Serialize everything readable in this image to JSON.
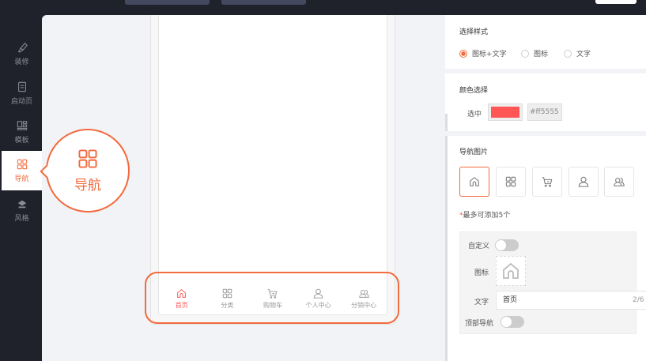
{
  "sidebar": {
    "items": [
      {
        "label": "装修",
        "icon": "brush-icon"
      },
      {
        "label": "启动页",
        "icon": "document-icon"
      },
      {
        "label": "模板",
        "icon": "template-icon"
      },
      {
        "label": "导航",
        "icon": "grid-icon"
      },
      {
        "label": "风格",
        "icon": "paint-bucket-icon"
      }
    ]
  },
  "callout": {
    "label": "导航"
  },
  "preview": {
    "tabs": [
      {
        "label": "首页",
        "icon": "home-icon"
      },
      {
        "label": "分类",
        "icon": "grid-icon"
      },
      {
        "label": "购物车",
        "icon": "cart-icon"
      },
      {
        "label": "个人中心",
        "icon": "user-icon"
      },
      {
        "label": "分销中心",
        "icon": "users-icon"
      }
    ]
  },
  "settings": {
    "style_title": "选择样式",
    "style_options": [
      "图标+文字",
      "图标",
      "文字"
    ],
    "color_title": "颜色选择",
    "selected_label": "选中",
    "selected_color": "#ff5555",
    "selected_hex": "#ff5555",
    "nav_images_title": "导航图片",
    "limit_note_star": "*",
    "limit_note": "最多可添加5个",
    "custom_label": "自定义",
    "icon_label": "图标",
    "text_label": "文字",
    "text_value": "首页",
    "text_count": "2/6",
    "top_nav_label": "顶部导航"
  },
  "colors": {
    "accent": "#f26a3d",
    "active": "#ff5555",
    "dark": "#1f222b"
  }
}
